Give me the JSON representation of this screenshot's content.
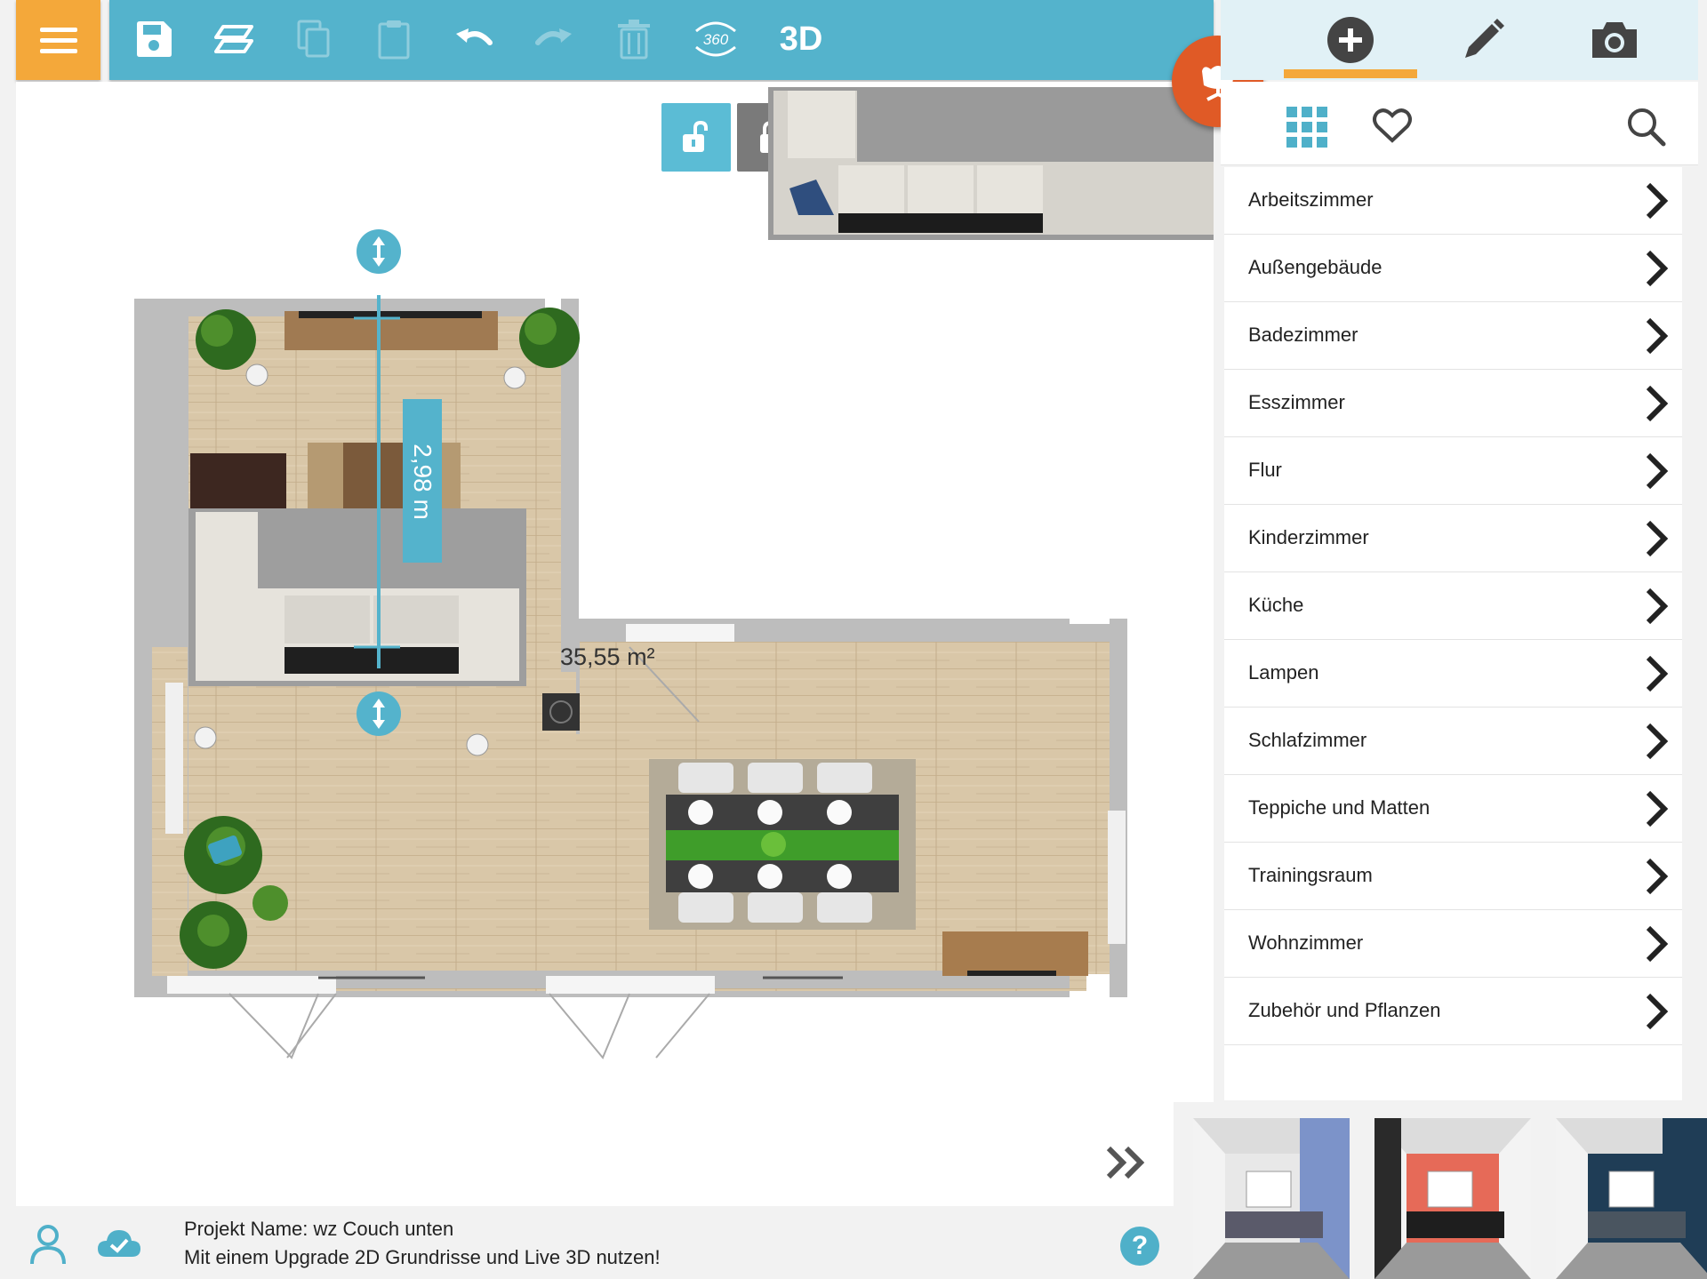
{
  "toolbar": {
    "view_3d_label": "3D",
    "view_360_label": "360"
  },
  "canvas": {
    "dimension_label": "2,98 m",
    "area_label": "35,55 m²"
  },
  "panel": {
    "categories": [
      {
        "label": "Arbeitszimmer"
      },
      {
        "label": "Außengebäude"
      },
      {
        "label": "Badezimmer"
      },
      {
        "label": "Esszimmer"
      },
      {
        "label": "Flur"
      },
      {
        "label": "Kinderzimmer"
      },
      {
        "label": "Küche"
      },
      {
        "label": "Lampen"
      },
      {
        "label": "Schlafzimmer"
      },
      {
        "label": "Teppiche und Matten"
      },
      {
        "label": "Trainingsraum"
      },
      {
        "label": "Wohnzimmer"
      },
      {
        "label": "Zubehör und Pflanzen"
      }
    ]
  },
  "status": {
    "project_name": "Projekt Name: wz Couch unten",
    "upgrade_hint": "Mit einem Upgrade 2D Grundrisse und Live 3D nutzen!",
    "help_label": "?"
  },
  "colors": {
    "toolbar": "#54b3cc",
    "menu_button": "#f4a83a",
    "furniture_button": "#e05a26",
    "tab_underline": "#f4a83a",
    "panel_header": "#e1f1f6",
    "floor": "#d8c4a3",
    "wall": "#bdbdbd",
    "dimension": "#54b3cc"
  },
  "icons": {
    "menu": "hamburger-icon",
    "save": "save-icon",
    "layers": "layers-icon",
    "copy": "copy-icon",
    "paste": "paste-icon",
    "undo": "undo-icon",
    "redo": "redo-icon",
    "delete": "trash-icon",
    "add": "plus-circle-icon",
    "edit": "pencil-icon",
    "camera": "camera-icon",
    "grid": "grid-icon",
    "favorite": "heart-icon",
    "search": "search-icon",
    "user": "user-icon",
    "cloud": "cloud-check-icon",
    "help": "help-icon",
    "furniture": "chair-icon",
    "expand": "double-chevron-right-icon"
  }
}
